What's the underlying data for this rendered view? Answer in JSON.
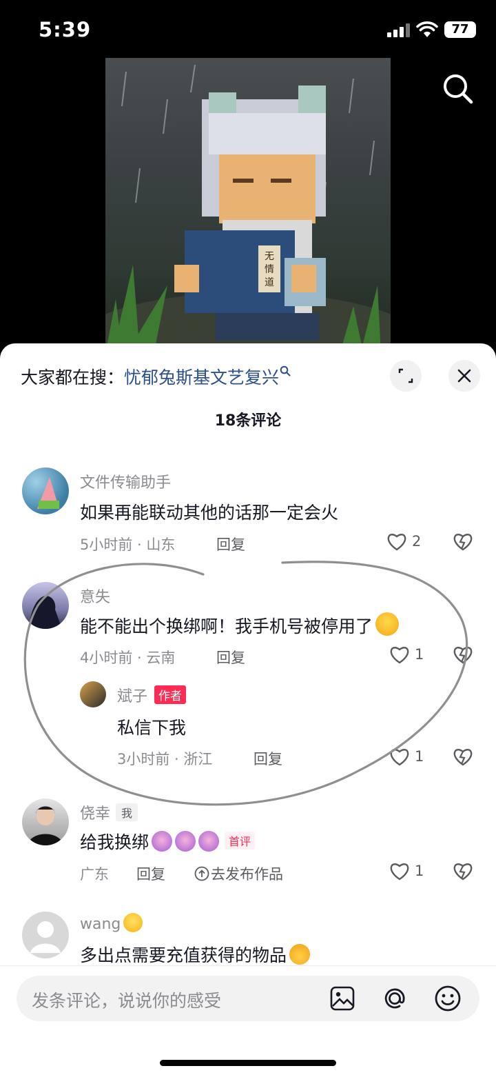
{
  "status_bar": {
    "time": "5:39",
    "battery": "77"
  },
  "trending": {
    "label": "大家都在搜：",
    "keyword": "忧郁兔斯基文艺复兴"
  },
  "comment_count": "18条评论",
  "reply_label": "回复",
  "comments": [
    {
      "user": "文件传输助手",
      "text": "如果再能联动其他的话那一定会火",
      "meta": "5小时前 · 山东",
      "likes": "2"
    },
    {
      "user": "意失",
      "text": "能不能出个换绑啊！我手机号被停用了",
      "meta": "4小时前 · 云南",
      "likes": "1"
    },
    {
      "user": "斌子",
      "badge": "作者",
      "text": "私信下我",
      "meta": "3小时前 · 浙江",
      "likes": "1"
    },
    {
      "user": "侥幸",
      "badge": "我",
      "text": "给我换绑",
      "first_badge": "首评",
      "meta": "广东",
      "publish": "去发布作品",
      "likes": "1"
    },
    {
      "user": "wang",
      "text": "多出点需要充值获得的物品"
    }
  ],
  "input": {
    "placeholder": "发条评论，说说你的感受"
  },
  "colors": {
    "accent": "#fe2c55",
    "link": "#2b4f8c",
    "annotation": "#8f8f8f"
  },
  "icons": [
    "search-icon",
    "expand-icon",
    "close-icon",
    "heart-icon",
    "dislike-icon",
    "image-icon",
    "at-icon",
    "emoji-icon"
  ]
}
